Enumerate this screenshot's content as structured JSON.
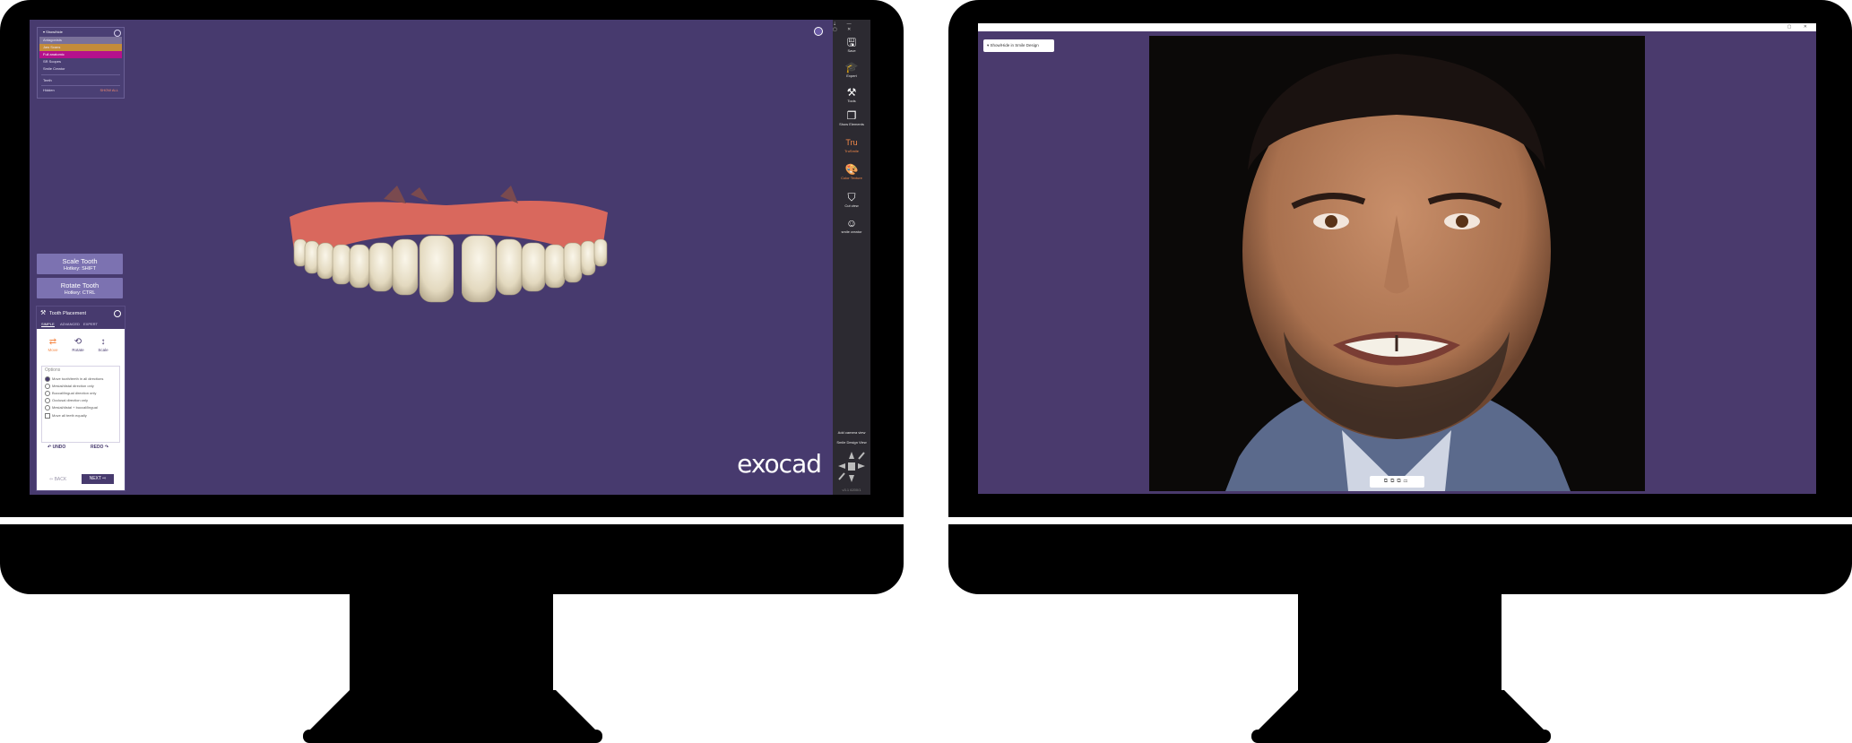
{
  "left_monitor": {
    "scene_tree": {
      "header": "Show/hide",
      "items": [
        "Antagonists",
        "Jaw Scans",
        "Full anatomic",
        "SR Scopes",
        "Smile Creator"
      ],
      "teeth_label": "Teeth",
      "hidden_label": "Hidden",
      "show_all_label": "SHOW ALL"
    },
    "hotkeys": {
      "scale": {
        "label": "Scale Tooth",
        "hotkey": "Hotkey: SHIFT"
      },
      "rotate": {
        "label": "Rotate Tooth",
        "hotkey": "Hotkey: CTRL"
      }
    },
    "tooth_placement": {
      "title": "Tooth Placement",
      "tabs": [
        "SIMPLE",
        "ADVANCED",
        "EXPERT"
      ],
      "actions": [
        {
          "label": "Move",
          "icon": "swap-arrows-icon"
        },
        {
          "label": "Rotate",
          "icon": "rotate-icon"
        },
        {
          "label": "Scale",
          "icon": "vertical-arrows-icon"
        }
      ],
      "options_title": "Options",
      "options": [
        {
          "label": "Move tooth/teeth in all directions",
          "type": "radio",
          "checked": true
        },
        {
          "label": "Mesial/distal direction only",
          "type": "radio",
          "checked": false
        },
        {
          "label": "Buccal/lingual direction only",
          "type": "radio",
          "checked": false
        },
        {
          "label": "Occlusal direction only",
          "type": "radio",
          "checked": false
        },
        {
          "label": "Mesial/distal + buccal/lingual",
          "type": "radio",
          "checked": false
        },
        {
          "label": "Move all teeth equally",
          "type": "checkbox",
          "checked": false
        }
      ],
      "undo": "↶ UNDO",
      "redo": "REDO ↷",
      "back": "⇦ BACK",
      "next": "NEXT ⇨"
    },
    "toolbar": {
      "items": [
        {
          "label": "Save",
          "icon": "save-icon",
          "accent": false
        },
        {
          "label": "Expert",
          "icon": "graduation-cap-icon",
          "accent": false
        },
        {
          "label": "Tools",
          "icon": "tools-icon",
          "accent": false
        },
        {
          "label": "Show Elements",
          "icon": "elements-icon",
          "accent": false
        },
        {
          "label": "TruSmile",
          "icon": "trusmile-icon",
          "accent": true
        },
        {
          "label": "Color Texture",
          "icon": "palette-icon",
          "accent": true
        },
        {
          "label": "Cut view",
          "icon": "cut-view-icon",
          "accent": false
        },
        {
          "label": "smile creator",
          "icon": "face-icon",
          "accent": false
        }
      ],
      "add_camera_view": "Add camera view",
      "smile_design_view": "Smile Design View",
      "version": "v3.1 6200/1"
    },
    "logo": "exocad",
    "colors": {
      "background": "#473a6e",
      "toolbar": "#2c2a31",
      "accent": "#f58a4a"
    }
  },
  "right_monitor": {
    "chip_label": "Show/Hide in Smile Design",
    "photo_toolbar_icons": [
      "upper-jaw-icon",
      "lower-jaw-icon",
      "both-jaws-icon",
      "tooth-icon"
    ],
    "colors": {
      "background": "#4a3a6d"
    }
  }
}
